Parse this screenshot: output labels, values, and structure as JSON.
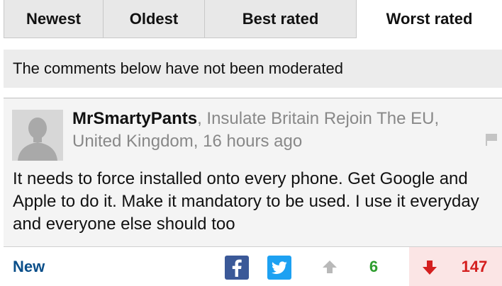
{
  "tabs": [
    {
      "label": "Newest",
      "active": false
    },
    {
      "label": "Oldest",
      "active": false
    },
    {
      "label": "Best rated",
      "active": false
    },
    {
      "label": "Worst rated",
      "active": true
    }
  ],
  "notice": "The comments below have not been moderated",
  "comment": {
    "author": "MrSmartyPants",
    "meta": ", Insulate Britain Rejoin The EU, United Kingdom, 16 hours ago",
    "body": "It needs to force installed onto every phone. Get Google and Apple to do it. Make it mandatory to be used. I use it everyday and everyone else should too",
    "new_label": "New",
    "upvotes": "6",
    "downvotes": "147"
  },
  "icons": {
    "avatar": "default-avatar-silhouette",
    "flag": "flag-icon",
    "facebook": "facebook-icon",
    "twitter": "twitter-icon",
    "upvote": "arrow-up-icon",
    "downvote": "arrow-down-icon"
  },
  "colors": {
    "facebook": "#3b5998",
    "twitter": "#1da1f2",
    "upvote": "#2e9d2e",
    "downvote": "#d41f1f",
    "link": "#0b4f8a"
  }
}
